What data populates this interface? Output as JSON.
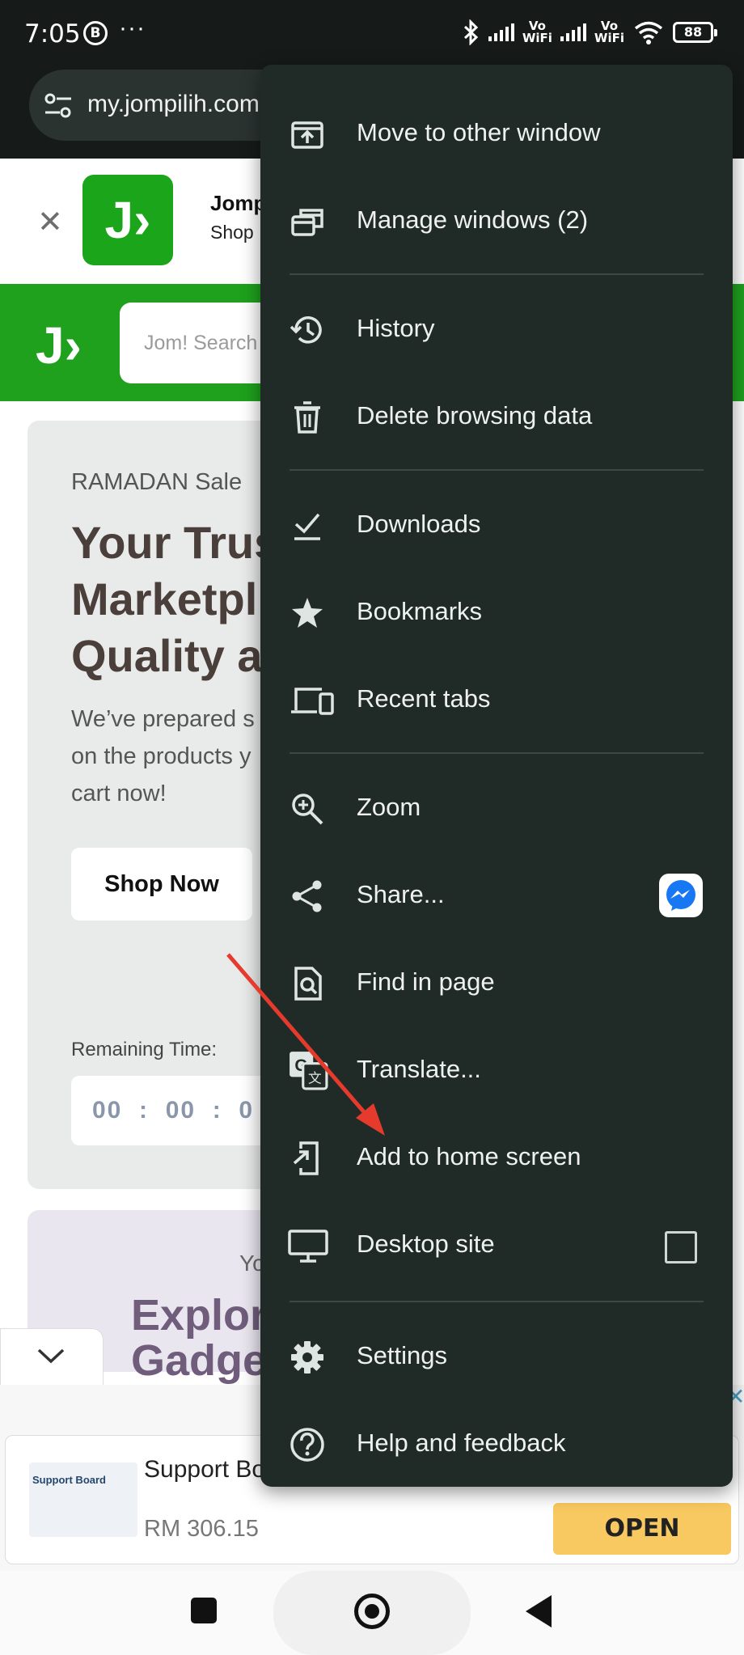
{
  "status_bar": {
    "time": "7:05",
    "b_icon": "B",
    "more": "···",
    "vowifi_1": "Vo\nWiFi",
    "vowifi_2": "Vo\nWiFi",
    "battery": "88"
  },
  "url_bar": {
    "url": "my.jompilih.com"
  },
  "app_banner": {
    "close": "✕",
    "logo": "J›",
    "title": "Jomp",
    "subtitle": "Shop"
  },
  "site_header": {
    "logo": "J›",
    "search_placeholder": "Jom! Search"
  },
  "hero": {
    "tag": "RAMADAN Sale",
    "title": "Your Trus\nMarketpl\nQuality a",
    "description": "We’ve prepared s\non the products y\ncart now!",
    "cta": "Shop Now",
    "remaining_label": "Remaining Time:",
    "timer": "00  :  00  :  0"
  },
  "promo": {
    "kicker": "Yo",
    "title": "Explore\nGadge"
  },
  "ad": {
    "thumb_label": "Support Board",
    "title": "Support Bo",
    "price": "RM 306.15",
    "open": "OPEN",
    "close": "✕"
  },
  "menu": {
    "items": [
      {
        "label": "Move to other window",
        "icon": "move-window-icon"
      },
      {
        "label": "Manage windows (2)",
        "icon": "manage-windows-icon"
      },
      {
        "label": "History",
        "icon": "history-icon"
      },
      {
        "label": "Delete browsing data",
        "icon": "trash-icon"
      },
      {
        "label": "Downloads",
        "icon": "download-icon"
      },
      {
        "label": "Bookmarks",
        "icon": "star-icon"
      },
      {
        "label": "Recent tabs",
        "icon": "devices-icon"
      },
      {
        "label": "Zoom",
        "icon": "zoom-icon"
      },
      {
        "label": "Share...",
        "icon": "share-icon"
      },
      {
        "label": "Find in page",
        "icon": "find-in-page-icon"
      },
      {
        "label": "Translate...",
        "icon": "translate-icon"
      },
      {
        "label": "Add to home screen",
        "icon": "add-to-home-icon"
      },
      {
        "label": "Desktop site",
        "icon": "desktop-icon"
      },
      {
        "label": "Settings",
        "icon": "gear-icon"
      },
      {
        "label": "Help and feedback",
        "icon": "help-icon"
      }
    ],
    "desktop_site_checked": false
  },
  "colors": {
    "menu_bg": "#202b28",
    "site_green": "#1fa11d",
    "annotation_red": "#e53a2c",
    "open_button": "#f8c960"
  }
}
